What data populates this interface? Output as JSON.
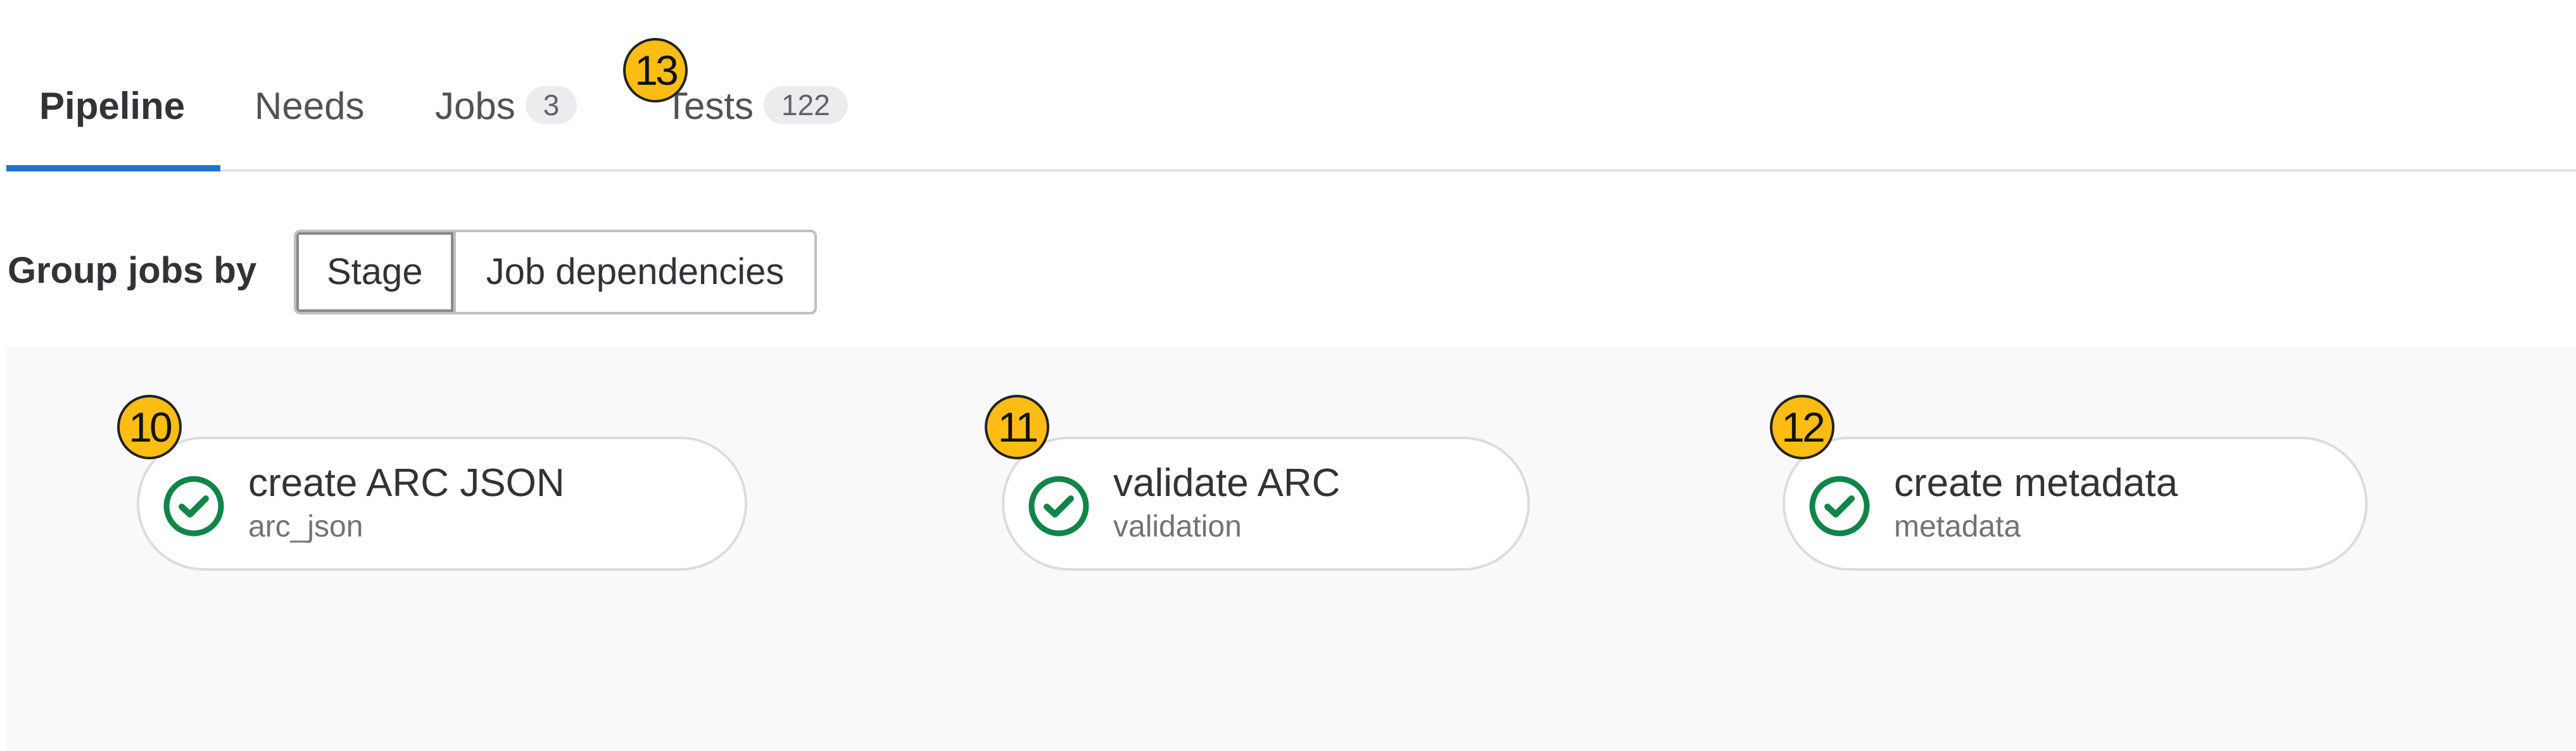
{
  "tabs": [
    {
      "label": "Pipeline",
      "active": true
    },
    {
      "label": "Needs"
    },
    {
      "label": "Jobs",
      "count": "3"
    },
    {
      "label": "Tests",
      "count": "122"
    }
  ],
  "group_by": {
    "label": "Group jobs by",
    "options": [
      "Stage",
      "Job dependencies"
    ],
    "selected": "Stage"
  },
  "jobs": [
    {
      "name": "create ARC JSON",
      "stage": "arc_json",
      "status_icon": "check-circle-icon"
    },
    {
      "name": "validate ARC",
      "stage": "validation",
      "status_icon": "check-circle-icon"
    },
    {
      "name": "create metadata",
      "stage": "metadata",
      "status_icon": "check-circle-icon"
    }
  ],
  "markers": [
    "10",
    "11",
    "12",
    "13"
  ],
  "colors": {
    "success": "#108548",
    "active_tab_underline": "#1f75cb",
    "marker_fill": "#fbbd14"
  }
}
